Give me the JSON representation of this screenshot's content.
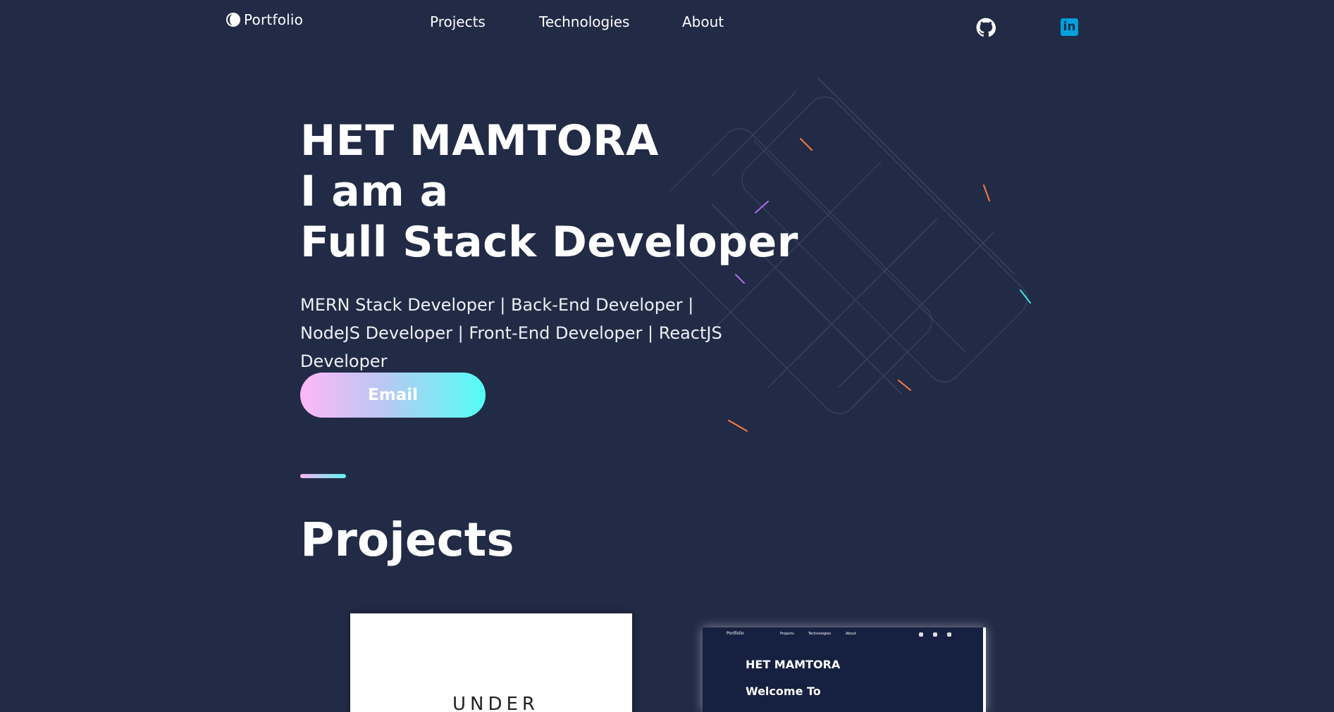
{
  "nav": {
    "logo_text": "Portfolio",
    "links": [
      "Projects",
      "Technologies",
      "About"
    ],
    "icons": [
      "github-icon",
      "linkedin-icon"
    ],
    "linkedin_glyph": "in"
  },
  "hero": {
    "name": "HET MAMTORA",
    "line2": "I am a",
    "line3": "Full Stack Developer",
    "roles": "MERN Stack Developer | Back-End Developer | NodeJS Developer | Front-End Developer | ReactJS Developer",
    "email_button": "Email"
  },
  "projects": {
    "title": "Projects",
    "card1_text": "UNDER",
    "card2": {
      "logo": "Portfolio",
      "nav": [
        "Projects",
        "Technologies",
        "About"
      ],
      "title": "HET MAMTORA",
      "subtitle": "Welcome To"
    }
  },
  "colors": {
    "background": "#222b45",
    "gradient_start": "#fdb7f6",
    "gradient_end": "#52fdf6",
    "linkedin": "#00a0dc"
  }
}
